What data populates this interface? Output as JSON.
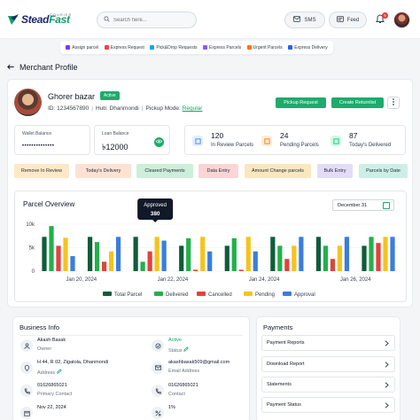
{
  "header": {
    "logo_main": "Stead",
    "logo_accent": "Fast",
    "logo_sub": "COURIER",
    "search_placeholder": "Search here...",
    "sms_label": "SMS",
    "feed_label": "Feed",
    "notification_count": "9"
  },
  "quick_actions": [
    {
      "label": "Assign parcel",
      "color": "#7c3aed"
    },
    {
      "label": "Express Request",
      "color": "#ef4444"
    },
    {
      "label": "Pick&Drop Requests",
      "color": "#0ea5e9"
    },
    {
      "label": "Express Parcels",
      "color": "#8b5cf6"
    },
    {
      "label": "Urgent Parcels",
      "color": "#f97316"
    },
    {
      "label": "Express Delivery",
      "color": "#2563eb"
    }
  ],
  "page": {
    "title": "Merchant Profile"
  },
  "merchant": {
    "name": "Ghorer bazar",
    "status": "Active",
    "id_line": "ID: 1234567890",
    "hub_line": "Hub: Dhanmondi",
    "pickup_label": "Pickup Mode:",
    "pickup_mode": "Regular"
  },
  "actions": {
    "pickup_request": "Pickup Request",
    "create_returnlist": "Create Returnlist"
  },
  "balances": {
    "wallet_label": "Wallet Balance",
    "wallet_value": "••••••••••••••",
    "loan_label": "Loan Balance",
    "loan_value": "৳12000"
  },
  "stats": [
    {
      "value": "120",
      "label": "In Review Parcels",
      "color": "#3b82f6"
    },
    {
      "value": "24",
      "label": "Pending Parcels",
      "color": "#f97316"
    },
    {
      "value": "87",
      "label": "Today's Delivered",
      "color": "#10b981"
    }
  ],
  "filters": [
    {
      "label": "Remove In Review",
      "bg": "#fde9c7"
    },
    {
      "label": "Today's Delivery",
      "bg": "#fde2d4"
    },
    {
      "label": "Cleared Payments",
      "bg": "#cdeed9"
    },
    {
      "label": "Data Entry",
      "bg": "#fbd5d5"
    },
    {
      "label": "Amount Change parcels",
      "bg": "#f9e7bf"
    },
    {
      "label": "Bulk Entry",
      "bg": "#e3dcf7"
    },
    {
      "label": "Parcels by Date",
      "bg": "#cdeee6"
    }
  ],
  "overview": {
    "title": "Parcel Overview",
    "date": "December 31",
    "tooltip_label": "Approved",
    "tooltip_value": "380"
  },
  "chart_data": {
    "type": "bar",
    "categories": [
      "Jan 20, 2024",
      "Jan 22, 2024",
      "Jan 24, 2024",
      "Jan 26, 2024"
    ],
    "ylim": [
      0,
      10000
    ],
    "yticks": [
      "0",
      "5k",
      "10k"
    ],
    "series": [
      {
        "name": "Total Parcel",
        "color": "#0f5c3b",
        "values": [
          7300,
          7300,
          5400,
          7300
        ]
      },
      {
        "name": "Delivered",
        "color": "#22b04b",
        "values": [
          9600,
          2000,
          7000,
          5400
        ]
      },
      {
        "name": "Cancelled",
        "color": "#e0433b",
        "values": [
          5400,
          4200,
          300,
          2600
        ]
      },
      {
        "name": "Pending",
        "color": "#f6c31b",
        "values": [
          7100,
          7300,
          7300,
          5400
        ]
      },
      {
        "name": "Approval",
        "color": "#3a7de0",
        "values": [
          3200,
          6500,
          4200,
          7300
        ]
      }
    ],
    "legend_position": "bottom"
  },
  "business_info": {
    "title": "Business Info",
    "owner_value": "Akash Basak",
    "owner_label": "Owner",
    "status_value": "Active",
    "status_label": "Status",
    "address_value": "H 44, R 02, Zigatola, Dhanmondi",
    "address_label": "Address",
    "email_value": "akashbasak509@gmail.com",
    "email_label": "Email Address",
    "primary_value": "01626865021",
    "primary_label": "Primary Contact",
    "contact_value": "01626865021",
    "contact_label": "Contact",
    "date_value": "Nov 22, 2024",
    "percent_value": "1%"
  },
  "payments": {
    "title": "Payments",
    "items": [
      "Payment Reports",
      "Download Report",
      "Statements",
      "Payment Status"
    ]
  }
}
